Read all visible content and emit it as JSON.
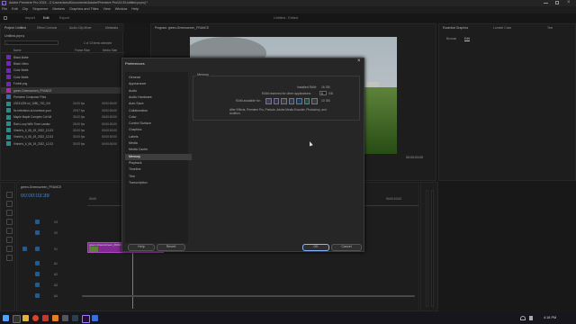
{
  "app": {
    "title": "Adobe Premiere Pro 2024 - C:\\Users\\tahul\\Documents\\Adobe\\Premiere Pro\\24.0\\Untitled.prproj *",
    "center_title": "Untitled - Edited",
    "logo_text": "Pr"
  },
  "menu": [
    "File",
    "Edit",
    "Clip",
    "Sequence",
    "Markers",
    "Graphics and Titles",
    "View",
    "Window",
    "Help"
  ],
  "workspace_tabs": [
    "Import",
    "Edit",
    "Export"
  ],
  "project_panel": {
    "tabs": [
      "Project: Untitled",
      "Effect Controls",
      "Audio Clip Mixer",
      "Metadata"
    ],
    "project_name": "Untitled.prproj",
    "status": "1 of 13 items selected",
    "col_name": "Name",
    "col_rate": "Frame Rate",
    "col_start": "Media Start",
    "items": [
      {
        "name": "Black Matte",
        "rate": "",
        "start": "",
        "color": "#8a2bd6"
      },
      {
        "name": "Black Video",
        "rate": "",
        "start": "",
        "color": "#8a2bd6"
      },
      {
        "name": "Color Matte",
        "rate": "",
        "start": "",
        "color": "#8a2bd6"
      },
      {
        "name": "Color Matte",
        "rate": "",
        "start": "",
        "color": "#8a2bd6"
      },
      {
        "name": "Fortnit.png",
        "rate": "",
        "start": "",
        "color": "#8a2bd6"
      },
      {
        "name": "green-Greenscreen_FRANCE",
        "rate": "",
        "start": "",
        "color": "#c23ac2"
      },
      {
        "name": "Premiere Composer Files",
        "rate": "",
        "start": "",
        "color": "#3a7fd5"
      },
      {
        "name": "20231229-lol_1080_720_24f",
        "rate": "24.00 fps",
        "start": "00:00:00:00",
        "color": "#2fa3a3"
      },
      {
        "name": "5x-television-to-increase-your",
        "rate": "29.97 fps",
        "start": "00:00:00:00",
        "color": "#2fa3a3"
      },
      {
        "name": "Maple Maple Complex Cut Wi",
        "rate": "30.00 fps",
        "start": "00:00:00:00",
        "color": "#2fa3a3"
      },
      {
        "name": "Rain Loop With Time Landsc",
        "rate": "25.00 fps",
        "start": "00:00:00:00",
        "color": "#2fa3a3"
      },
      {
        "name": "Vinnie's_4_06_19_2022_12-03",
        "rate": "30.00 fps",
        "start": "00:00:00:00",
        "color": "#2fa3a3"
      },
      {
        "name": "Vinnie's_4_06_19_2022_12-03",
        "rate": "30.00 fps",
        "start": "00:00:00:00",
        "color": "#2fa3a3"
      },
      {
        "name": "Vinnie's_4_06_19_2022_12-03",
        "rate": "30.00 fps",
        "start": "00:00:00:00",
        "color": "#2fa3a3"
      }
    ]
  },
  "program_panel": {
    "title": "Program: green-Greenscreen_FRANCE",
    "timecode": "00:00:03:00"
  },
  "right_panel": {
    "tabs": [
      "Essential Graphics",
      "Lumetri Color",
      "Text"
    ],
    "subtabs": [
      "Browse",
      "Edit"
    ]
  },
  "timeline": {
    "tab": "green-Greenscreen_FRANCE",
    "timecode": "00:00:03:39",
    "ruler": [
      "00:00",
      "00:00:05:00",
      "00:00:10:00"
    ],
    "video_tracks": [
      "V3",
      "V2",
      "V1"
    ],
    "audio_tracks": [
      "A1",
      "A2",
      "A3",
      "A4"
    ],
    "clip_label": "green-Greenscreen_FRANCE"
  },
  "dialog": {
    "title": "Preferences",
    "categories": [
      "General",
      "Appearance",
      "Audio",
      "Audio Hardware",
      "Auto Save",
      "Collaboration",
      "Color",
      "Control Surface",
      "Graphics",
      "Labels",
      "Media",
      "Media Cache",
      "Memory",
      "Playback",
      "Timeline",
      "Trim",
      "Transcription"
    ],
    "selected_index": 12,
    "section_title": "Memory",
    "installed_label": "Installed RAM:",
    "installed_value": "16 GB",
    "reserved_label": "RAM reserved for other applications:",
    "reserved_value": "6",
    "reserved_unit": "GB",
    "available_label": "RAM available for:",
    "available_value": "10 GB",
    "note": "After Effects, Premiere Pro, Prelude, Adobe Media Encoder, Photoshop, and Audition.",
    "help_label": "Help",
    "revert_label": "Revert",
    "ok_label": "OK",
    "cancel_label": "Cancel"
  },
  "taskbar": {
    "time": "4:18 PM"
  }
}
